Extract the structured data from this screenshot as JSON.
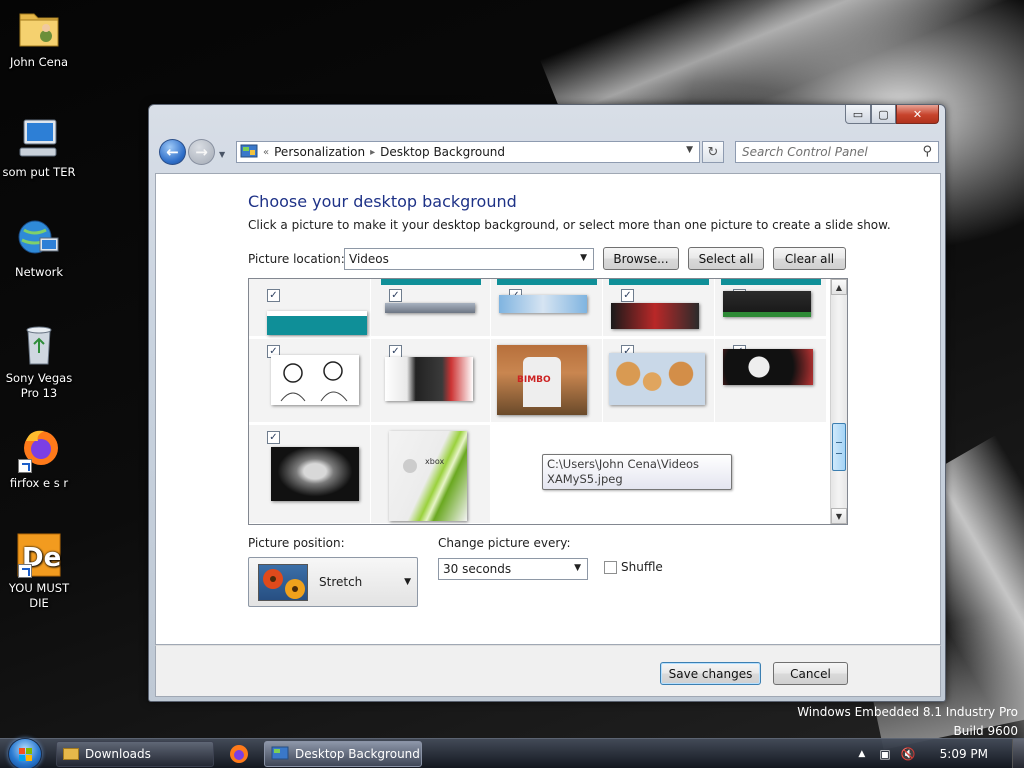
{
  "desktop": {
    "icons": [
      {
        "label": "John Cena",
        "icon": "user-folder-icon"
      },
      {
        "label": "som put TER",
        "icon": "computer-icon"
      },
      {
        "label": "Network",
        "icon": "network-icon"
      },
      {
        "label": "Sony Vegas Pro 13",
        "icon": "recycle-bin-icon"
      },
      {
        "label": "firfox e s r",
        "icon": "firefox-icon"
      },
      {
        "label": "YOU MUST DIE",
        "icon": "app-shortcut-icon"
      }
    ],
    "watermark": {
      "line1": "Windows Embedded 8.1 Industry Pro",
      "line2": "Build 9600"
    }
  },
  "window": {
    "controls": {
      "minimize": "▭",
      "maximize": "▢",
      "close": "✕"
    },
    "address": {
      "crumbs": [
        "Personalization",
        "Desktop Background"
      ],
      "recent_glyph": "«",
      "separator": "▸"
    },
    "search_placeholder": "Search Control Panel",
    "title": "Choose your desktop background",
    "subtitle": "Click a picture to make it your desktop background, or select more than one picture to create a slide show.",
    "picture_location": {
      "label": "Picture location:",
      "value": "Videos"
    },
    "buttons": {
      "browse": "Browse...",
      "select_all": "Select all",
      "clear_all": "Clear all",
      "save": "Save changes",
      "cancel": "Cancel"
    },
    "tooltip": {
      "line1": "C:\\Users\\John Cena\\Videos",
      "line2": "XAMyS5.jpeg"
    },
    "thumbnail_text": {
      "bimbo": "BIMBO",
      "xbox": "xbox"
    },
    "picture_position": {
      "label": "Picture position:",
      "value": "Stretch"
    },
    "change_every": {
      "label": "Change picture every:",
      "value": "30 seconds"
    },
    "shuffle": {
      "label": "Shuffle",
      "checked": false
    }
  },
  "taskbar": {
    "items": [
      {
        "label": "Downloads",
        "icon": "folder-icon"
      },
      {
        "label": "",
        "icon": "firefox-icon"
      },
      {
        "label": "Desktop Background",
        "icon": "control-panel-icon"
      }
    ],
    "clock": "5:09 PM"
  },
  "colors": {
    "heading": "#1e3287",
    "accent": "#3c7fb1",
    "close": "#c7432c"
  }
}
